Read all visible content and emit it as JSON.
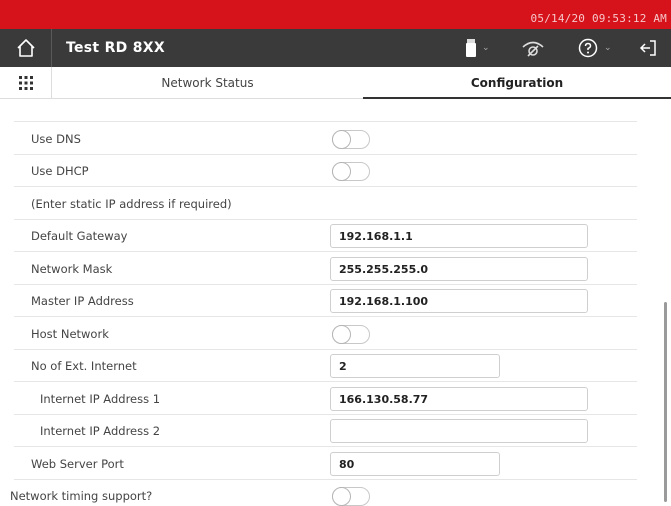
{
  "status_bar": {
    "datetime": "05/14/20 09:53:12 AM"
  },
  "header": {
    "title": "Test RD 8XX",
    "icons": [
      "home-icon",
      "usb-drive-icon",
      "signal-off-icon",
      "help-icon",
      "logout-icon"
    ]
  },
  "tabs": {
    "network_status": "Network Status",
    "configuration": "Configuration",
    "active": "Configuration"
  },
  "settings": {
    "use_dns": {
      "label": "Use DNS",
      "on": false
    },
    "use_dhcp": {
      "label": "Use DHCP",
      "on": false
    },
    "static_note": "(Enter static IP address if required)",
    "default_gateway": {
      "label": "Default Gateway",
      "value": "192.168.1.1"
    },
    "network_mask": {
      "label": "Network Mask",
      "value": "255.255.255.0"
    },
    "master_ip": {
      "label": "Master IP Address",
      "value": "192.168.1.100"
    },
    "host_network": {
      "label": "Host Network",
      "on": false
    },
    "ext_internet": {
      "label": "No of Ext. Internet",
      "value": "2"
    },
    "internet_ip_1": {
      "label": "Internet IP Address 1",
      "value": "166.130.58.77"
    },
    "internet_ip_2": {
      "label": "Internet IP Address 2",
      "value": ""
    },
    "web_server_port": {
      "label": "Web Server Port",
      "value": "80"
    },
    "network_timing": {
      "label": "Network timing support?",
      "on": false
    }
  },
  "colors": {
    "status_bar": "#d6121a",
    "title_bar": "#3a3a3a"
  }
}
